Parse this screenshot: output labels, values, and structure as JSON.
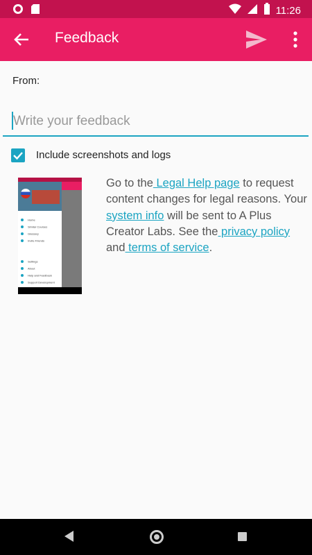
{
  "status_bar": {
    "time": "11:26"
  },
  "app_bar": {
    "title": "Feedback",
    "background_color": "#e91e63"
  },
  "form": {
    "from_label": "From:",
    "feedback_placeholder": "Write your feedback",
    "include_checkbox_label": "Include screenshots and logs",
    "include_checked": true
  },
  "description": {
    "part1": "Go to the",
    "legal_help_link": " Legal Help page",
    "part2": " to request content changes for legal reasons. Your",
    "system_info_link": " system info",
    "part3": " will be sent to A Plus Creator Labs. See the",
    "privacy_link": " privacy policy",
    "part4": " and",
    "terms_link": " terms of service",
    "part5": "."
  },
  "screenshot_preview": {
    "drawer_items": [
      "Home",
      "Similar Courses",
      "Glossary",
      "Invite Friends",
      "Settings",
      "About",
      "Help and Feedback",
      "Support Development"
    ]
  },
  "accent_color": "#1ba4c2"
}
